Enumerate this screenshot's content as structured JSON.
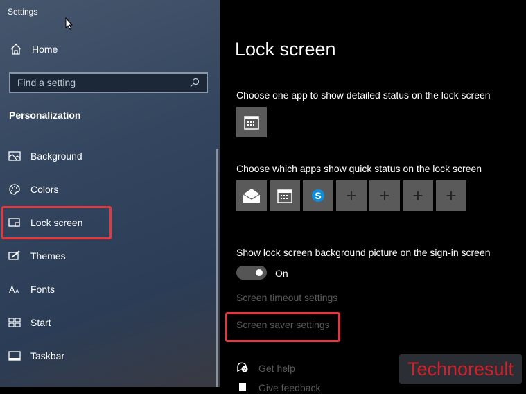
{
  "sidebar": {
    "app_title": "Settings",
    "home": "Home",
    "search_placeholder": "Find a setting",
    "section": "Personalization",
    "items": [
      {
        "label": "Background",
        "icon": "picture-icon"
      },
      {
        "label": "Colors",
        "icon": "palette-icon"
      },
      {
        "label": "Lock screen",
        "icon": "lock-screen-icon",
        "selected": true
      },
      {
        "label": "Themes",
        "icon": "brush-icon"
      },
      {
        "label": "Fonts",
        "icon": "fonts-icon"
      },
      {
        "label": "Start",
        "icon": "start-icon"
      },
      {
        "label": "Taskbar",
        "icon": "taskbar-icon"
      }
    ]
  },
  "main": {
    "title": "Lock screen",
    "detailed_label": "Choose one app to show detailed status on the lock screen",
    "detailed_app": "calendar-icon",
    "quick_label": "Choose which apps show quick status on the lock screen",
    "quick_apps": [
      "mail-icon",
      "calendar-icon",
      "skype-icon",
      "plus-icon",
      "plus-icon",
      "plus-icon",
      "plus-icon"
    ],
    "bg_label": "Show lock screen background picture on the sign-in screen",
    "toggle_state": "On",
    "timeout_link": "Screen timeout settings",
    "saver_link": "Screen saver settings",
    "help": "Get help",
    "feedback": "Give feedback"
  },
  "watermark": "Technoresult",
  "colors": {
    "highlight": "#e2383f",
    "tile": "#5a5a5a"
  }
}
